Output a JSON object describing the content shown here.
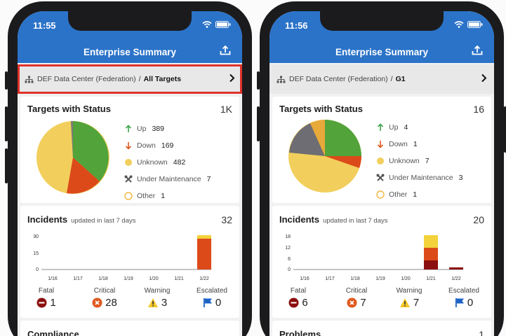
{
  "left": {
    "time": "11:55",
    "title": "Enterprise Summary",
    "breadcrumb": {
      "parent": "DEF Data Center (Federation)",
      "separator": "/",
      "target": "All Targets"
    },
    "targets": {
      "title": "Targets with Status",
      "count": "1K",
      "legend": [
        {
          "label": "Up",
          "value": "389",
          "icon": "arrow-up-icon",
          "color": "#52a33a"
        },
        {
          "label": "Down",
          "value": "169",
          "icon": "arrow-down-icon",
          "color": "#dc4a1a"
        },
        {
          "label": "Unknown",
          "value": "482",
          "icon": "unknown-dot-icon",
          "color": "#f2cf5c"
        },
        {
          "label": "Under Maintenance",
          "value": "7",
          "icon": "wrench-icon",
          "color": "#7a7a7a"
        },
        {
          "label": "Other",
          "value": "1",
          "icon": "other-ring-icon",
          "color": "#f2b742"
        }
      ]
    },
    "incidents": {
      "title": "Incidents",
      "subtitle": "updated in last 7 days",
      "count": "32",
      "y_ticks": [
        "30",
        "15",
        "0"
      ],
      "x_ticks": [
        "1/16",
        "1/17",
        "1/18",
        "1/19",
        "1/20",
        "1/21",
        "1/22"
      ],
      "stats": [
        {
          "label": "Fatal",
          "value": "1",
          "icon": "fatal-icon"
        },
        {
          "label": "Critical",
          "value": "28",
          "icon": "critical-icon"
        },
        {
          "label": "Warning",
          "value": "3",
          "icon": "warning-icon"
        },
        {
          "label": "Escalated",
          "value": "0",
          "icon": "flag-icon"
        }
      ]
    },
    "next_card": {
      "title": "Compliance"
    }
  },
  "right": {
    "time": "11:56",
    "title": "Enterprise Summary",
    "breadcrumb": {
      "parent": "DEF Data Center (Federation)",
      "separator": "/",
      "target": "G1"
    },
    "targets": {
      "title": "Targets with Status",
      "count": "16",
      "legend": [
        {
          "label": "Up",
          "value": "4",
          "icon": "arrow-up-icon",
          "color": "#52a33a"
        },
        {
          "label": "Down",
          "value": "1",
          "icon": "arrow-down-icon",
          "color": "#dc4a1a"
        },
        {
          "label": "Unknown",
          "value": "7",
          "icon": "unknown-dot-icon",
          "color": "#f2cf5c"
        },
        {
          "label": "Under Maintenance",
          "value": "3",
          "icon": "wrench-icon",
          "color": "#6d6d73"
        },
        {
          "label": "Other",
          "value": "1",
          "icon": "other-ring-icon",
          "color": "#e6a93a"
        }
      ]
    },
    "incidents": {
      "title": "Incidents",
      "subtitle": "updated in last 7 days",
      "count": "20",
      "y_ticks": [
        "18",
        "12",
        "6",
        "0"
      ],
      "x_ticks": [
        "1/16",
        "1/17",
        "1/18",
        "1/19",
        "1/20",
        "1/21",
        "1/22"
      ],
      "stats": [
        {
          "label": "Fatal",
          "value": "6",
          "icon": "fatal-icon"
        },
        {
          "label": "Critical",
          "value": "7",
          "icon": "critical-icon"
        },
        {
          "label": "Warning",
          "value": "7",
          "icon": "warning-icon"
        },
        {
          "label": "Escalated",
          "value": "0",
          "icon": "flag-icon"
        }
      ]
    },
    "next_card": {
      "title": "Problems",
      "count": "1"
    }
  },
  "colors": {
    "header_blue": "#2b73c8",
    "highlight_red": "#e0322a"
  }
}
